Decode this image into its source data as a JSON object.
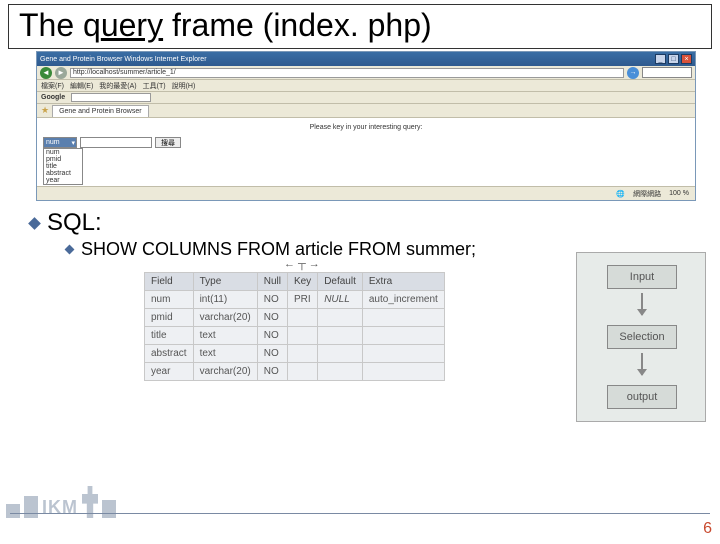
{
  "title": {
    "pre": "The q",
    "underlined": "uery",
    "post": " frame (index. php)"
  },
  "browser": {
    "window_title": "Gene and Protein Browser   Windows Internet Explorer",
    "url": "http://localhost/summer/article_1/",
    "menu": [
      "檔案(F)",
      "編輯(E)",
      "我的最愛(A)",
      "工具(T)",
      "說明(H)"
    ],
    "google_label": "Google",
    "tab_label": "Gene and Protein Browser",
    "instruction": "Please key in your interesting query:",
    "select_value": "num",
    "search_btn": "搜尋",
    "dropdown_options": [
      "num",
      "pmid",
      "title",
      "abstract",
      "year"
    ],
    "status_net": "網際網路",
    "status_zoom": "100 %"
  },
  "sql_label": "SQL:",
  "sql_code": "SHOW COLUMNS FROM article FROM summer;",
  "mini_label": "←┬→",
  "schema": {
    "headers": [
      "Field",
      "Type",
      "Null",
      "Key",
      "Default",
      "Extra"
    ],
    "rows": [
      [
        "num",
        "int(11)",
        "NO",
        "PRI",
        "NULL",
        "auto_increment"
      ],
      [
        "pmid",
        "varchar(20)",
        "NO",
        "",
        "",
        ""
      ],
      [
        "title",
        "text",
        "NO",
        "",
        "",
        ""
      ],
      [
        "abstract",
        "text",
        "NO",
        "",
        "",
        ""
      ],
      [
        "year",
        "varchar(20)",
        "NO",
        "",
        "",
        ""
      ]
    ]
  },
  "flow": {
    "b1": "Input",
    "b2": "Selection",
    "b3": "output"
  },
  "logo_text": "IKM",
  "page_number": "6"
}
